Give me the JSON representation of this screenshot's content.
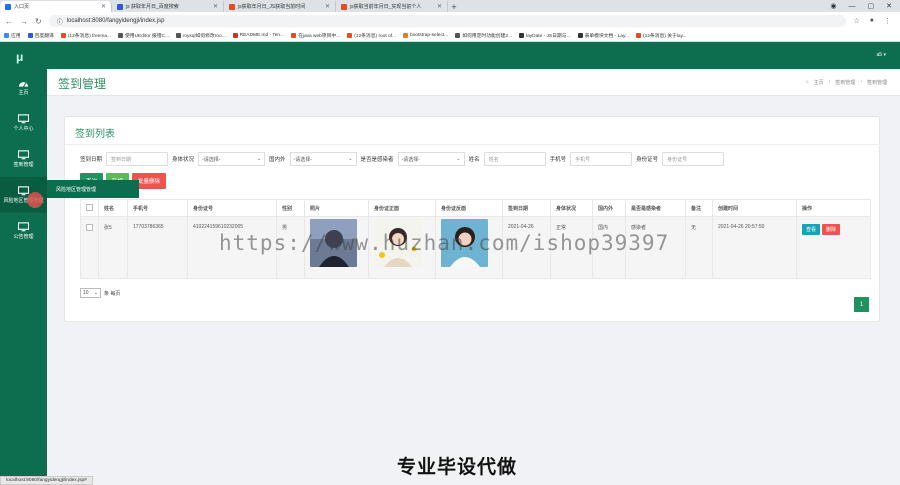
{
  "browser": {
    "tabs": [
      {
        "label": "入口页",
        "color": "#1a73e8",
        "active": true
      },
      {
        "label": "js 获取年月日_百度搜索",
        "color": "#2a5bd7"
      },
      {
        "label": "js获取年月日_JS获取当前时间",
        "color": "#e54c21"
      },
      {
        "label": "js获取当前年月日_实现当前个人",
        "color": "#e54c21"
      }
    ],
    "url": "localhost:8080/fangyidengji/index.jsp",
    "bookmarks": [
      {
        "label": "应用",
        "color": "#4285f4"
      },
      {
        "label": "百度翻译",
        "color": "#2a5bd7"
      },
      {
        "label": "(12条消息) freema...",
        "color": "#e54c21"
      },
      {
        "label": "使用UEditor 报错C...",
        "color": "#555555"
      },
      {
        "label": "mysql如何修改roo...",
        "color": "#555555"
      },
      {
        "label": "README.md - Ten...",
        "color": "#c0392b"
      },
      {
        "label": "在java web项目中...",
        "color": "#e54c21"
      },
      {
        "label": "(12条消息) root of...",
        "color": "#e54c21"
      },
      {
        "label": "bootstrap-select...",
        "color": "#e67e22"
      },
      {
        "label": "如何用定时功能创建2...",
        "color": "#555555"
      },
      {
        "label": "layDate - JS日期与...",
        "color": "#333333"
      },
      {
        "label": "表单模块文档 - Lay...",
        "color": "#333333"
      },
      {
        "label": "(12条消息) 关于lay...",
        "color": "#e54c21"
      }
    ]
  },
  "app": {
    "logo": "μ",
    "user": "a5 ▾",
    "sidebar": [
      {
        "label": "主页",
        "icon": "dashboard-icon"
      },
      {
        "label": "个人中心",
        "icon": "monitor-icon"
      },
      {
        "label": "签到管理",
        "icon": "monitor-icon"
      },
      {
        "label": "风险地区管理管理",
        "icon": "monitor-icon",
        "active": true
      },
      {
        "label": "公告管理",
        "icon": "monitor-icon"
      }
    ],
    "flyout": "风险地区管理管理"
  },
  "page": {
    "title": "签到管理",
    "breadcrumbs": [
      "主页",
      "签到管理",
      "签到管理"
    ],
    "panel_title": "签到列表"
  },
  "filters": {
    "date_label": "签到日期",
    "date_placeholder": "签到日期",
    "health_label": "身体状况",
    "health_value": "-请选择-",
    "region_label": "国内外",
    "region_value": "-请选择-",
    "contact_label": "是否是感染者",
    "contact_value": "-请选择-",
    "name_label": "姓名",
    "name_placeholder": "姓名",
    "phone_label": "手机号",
    "phone_placeholder": "手机号",
    "id_label": "身份证号",
    "id_placeholder": "身份证号"
  },
  "buttons": {
    "search": "查询",
    "add": "新增",
    "batch_delete": "批量删除",
    "colors": {
      "search": "#1e9361",
      "add": "#5cb85c",
      "delete": "#ef5350"
    }
  },
  "table": {
    "headers": [
      "",
      "姓名",
      "手机号",
      "身份证号",
      "性别",
      "照片",
      "身份证正面",
      "身份证反面",
      "签到日期",
      "身体状况",
      "国内外",
      "是否是感染者",
      "备注",
      "创建时间",
      "操作"
    ],
    "rows": [
      {
        "name": "张5",
        "phone": "17703786365",
        "id_card": "410224159610232005",
        "gender": "男",
        "sign_date": "2021-04-26",
        "health": "正常",
        "region": "国内",
        "infected": "感染者",
        "note": "无",
        "created": "2021-04-26 20:57:50",
        "view": "查看",
        "delete": "删除"
      }
    ]
  },
  "pager": {
    "size": "10",
    "suffix": "条 每页",
    "page": "1"
  },
  "overlay": {
    "watermark": "https://www.huzhan.com/ishop39397",
    "caption": "专业毕设代做",
    "status_url": "localhost:8080/fangyidengji/index.jsp#"
  }
}
